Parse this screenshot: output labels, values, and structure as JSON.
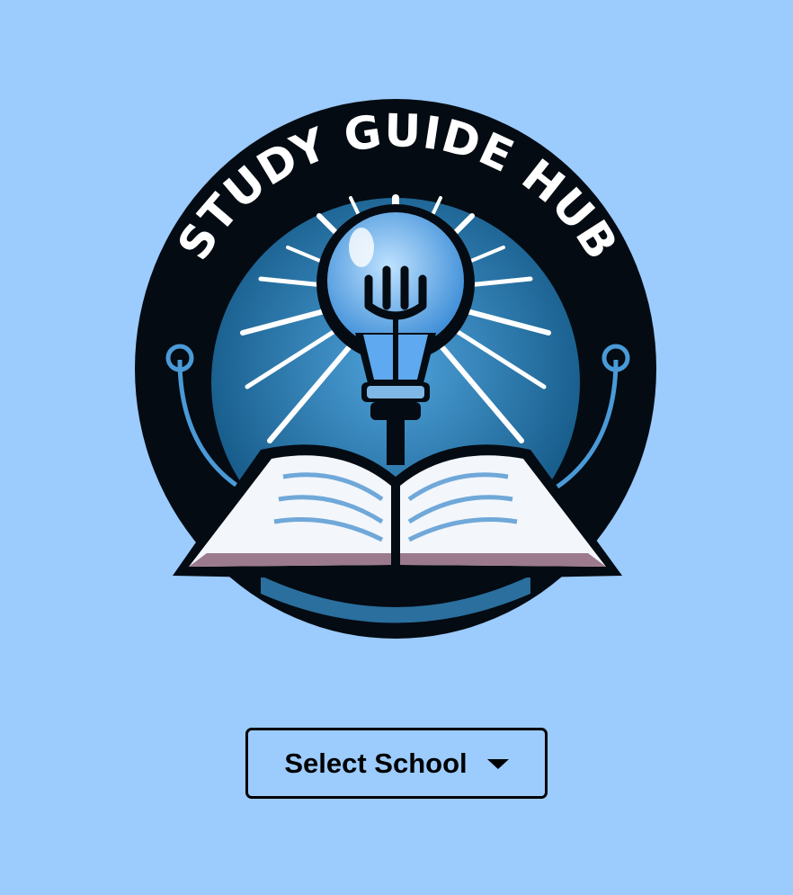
{
  "logo": {
    "text": "STUDY GUIDE HUB",
    "icon_names": [
      "light-bulb-icon",
      "open-book-icon"
    ],
    "colors": {
      "ring": "#040b12",
      "inner": "#1f6a9a",
      "rays": "#ffffff",
      "bulb": "#5ea9f0",
      "book_pages": "#f3f6fb",
      "book_edge": "#9a7a8c"
    }
  },
  "school_select": {
    "label": "Select School",
    "caret_icon": "caret-down-icon"
  },
  "colors": {
    "background": "#9ccbfd",
    "text": "#000000"
  }
}
